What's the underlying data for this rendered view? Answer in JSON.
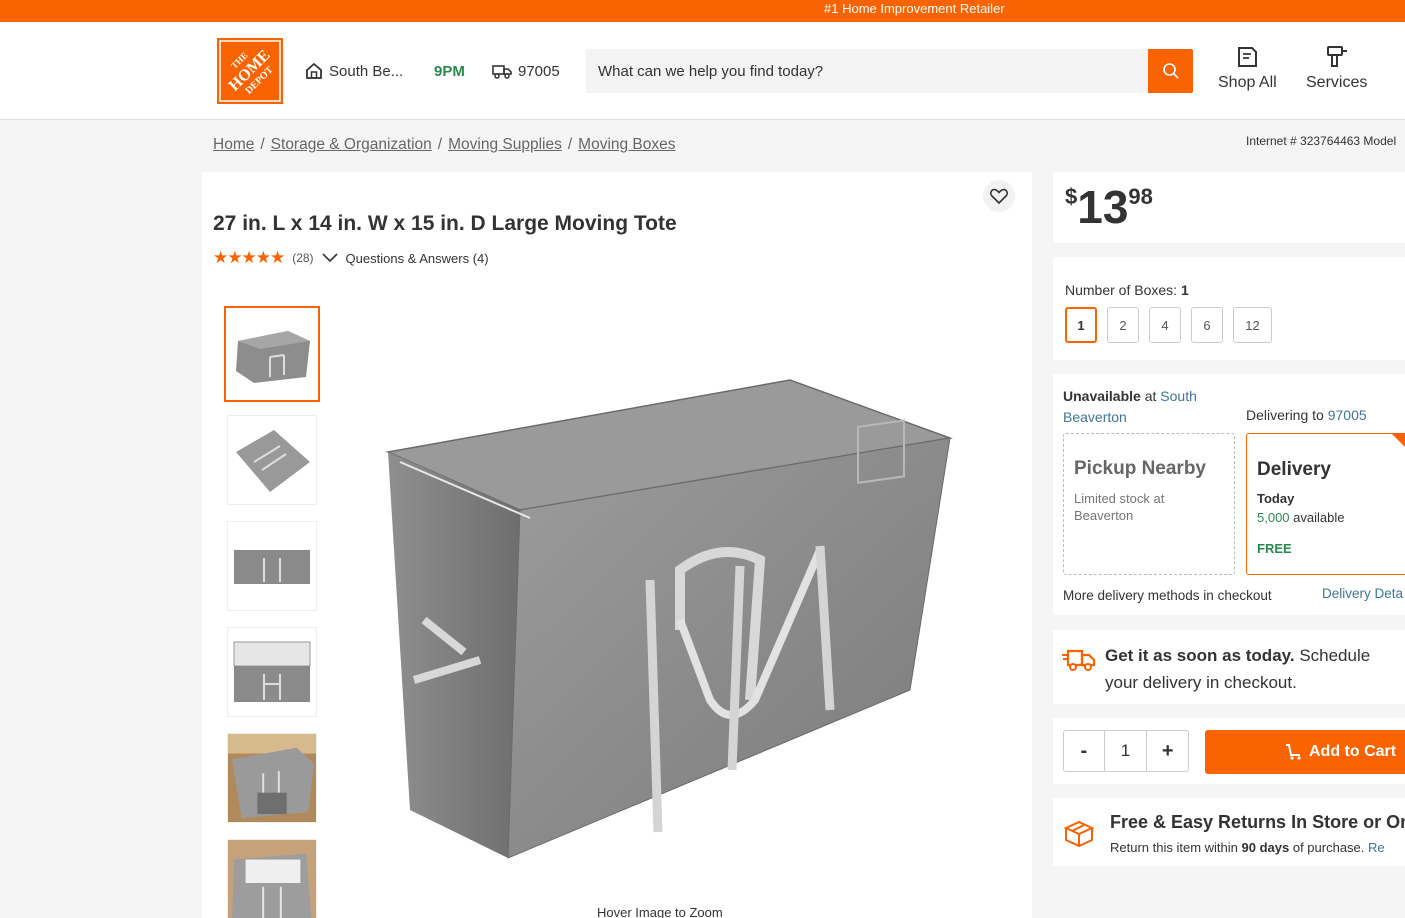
{
  "topbar": {
    "text": "#1 Home Improvement Retailer"
  },
  "header": {
    "logo_text": "THE HOME DEPOT",
    "store_name": "South Be...",
    "store_hours": "9PM",
    "zip": "97005",
    "search_placeholder": "What can we help you find today?",
    "shop_all": "Shop All",
    "services": "Services"
  },
  "breadcrumb": [
    "Home",
    "Storage & Organization",
    "Moving Supplies",
    "Moving Boxes"
  ],
  "internet_no": "Internet # 323764463  Model",
  "product": {
    "title": "27 in. L x 14 in. W x 15 in. D Large Moving Tote",
    "stars": "★★★★★",
    "review_count": "(28)",
    "qa": "Questions & Answers (4)",
    "hover_zoom": "Hover Image to Zoom"
  },
  "price": {
    "currency": "$",
    "dollars": "13",
    "cents": "98"
  },
  "box_selector": {
    "label": "Number of Boxes:",
    "value": "1",
    "options": [
      "1",
      "2",
      "4",
      "6",
      "12"
    ]
  },
  "fulfillment": {
    "unavailable": "Unavailable",
    "at": "at",
    "store": "South Beaverton",
    "delivering_to": "Delivering to",
    "zip": "97005",
    "pickup_title": "Pickup Nearby",
    "pickup_sub": "Limited stock at Beaverton",
    "delivery_title": "Delivery",
    "delivery_when": "Today",
    "delivery_qty": "5,000",
    "delivery_avail": "available",
    "delivery_cost": "FREE",
    "more_methods": "More delivery methods in checkout",
    "delivery_details": "Delivery Deta"
  },
  "soon": {
    "bold": "Get it as soon as today.",
    "rest": "Schedule your delivery in checkout."
  },
  "cart": {
    "minus": "-",
    "qty": "1",
    "plus": "+",
    "add_label": "Add to Cart"
  },
  "returns": {
    "title": "Free & Easy Returns In Store or On",
    "line_a": "Return this item within",
    "days": "90 days",
    "line_b": "of purchase.",
    "link": "Re"
  },
  "colors": {
    "brand": "#f96302",
    "green": "#2a8a4e",
    "link": "#3e7697"
  }
}
